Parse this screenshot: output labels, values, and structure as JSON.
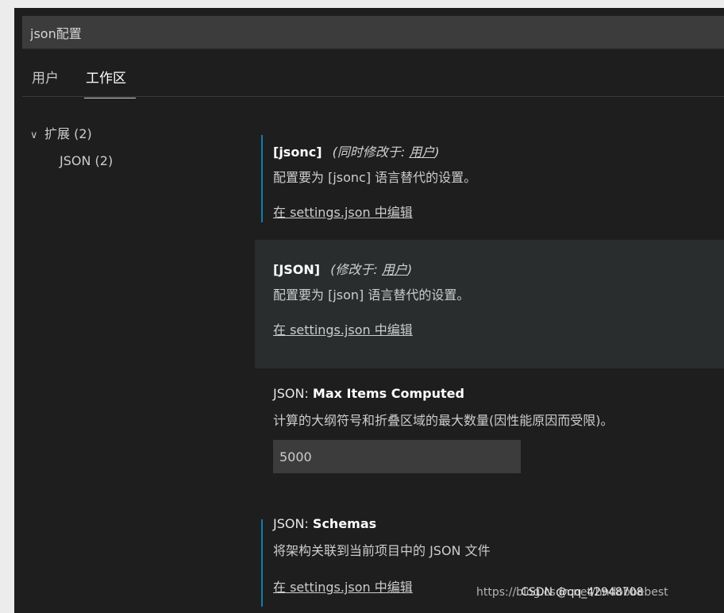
{
  "search": {
    "value": "json配置"
  },
  "tabs": [
    {
      "label": "用户",
      "active": false
    },
    {
      "label": "工作区",
      "active": true
    }
  ],
  "toc": {
    "group": {
      "label": "扩展",
      "count": "(2)"
    },
    "child": {
      "label": "JSON",
      "count": "(2)"
    }
  },
  "settings": [
    {
      "title": "[jsonc]",
      "modified_prefix": "(同时修改于: ",
      "modified_link": "用户",
      "modified_suffix": ")",
      "description": "配置要为 [jsonc] 语言替代的设置。",
      "edit_link": "在 settings.json 中编辑"
    },
    {
      "title": "[JSON]",
      "modified_prefix": "(修改于: ",
      "modified_link": "用户",
      "modified_suffix": ")",
      "description": "配置要为 [json] 语言替代的设置。",
      "edit_link": "在 settings.json 中编辑"
    },
    {
      "category": "JSON: ",
      "title": "Max Items Computed",
      "description": "计算的大纲符号和折叠区域的最大数量(因性能原因而受限)。",
      "value": "5000"
    },
    {
      "category": "JSON: ",
      "title": "Schemas",
      "description": "将架构关联到当前项目中的 JSON 文件",
      "edit_link": "在 settings.json 中编辑"
    }
  ],
  "watermark": {
    "url": "https://blog.csdn.net/hndobbebest",
    "credit": "CSDN @qq_42948708"
  },
  "colors": {
    "background": "#1e1e1e",
    "modified_indicator": "#0e7fad",
    "input_background": "#3c3c3c"
  }
}
